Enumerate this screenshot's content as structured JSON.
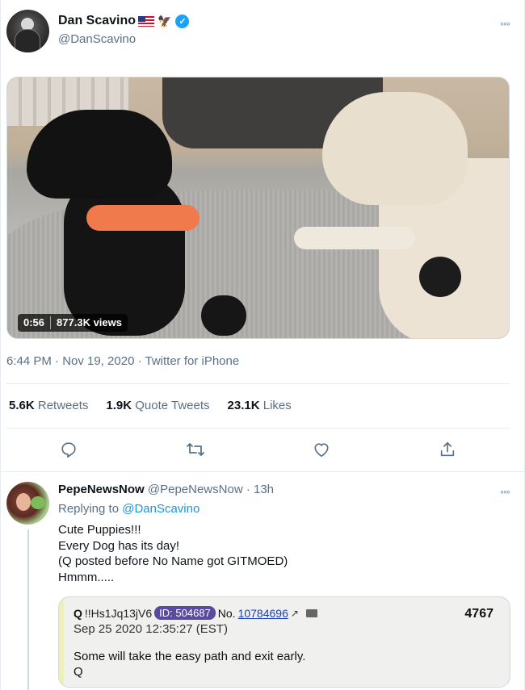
{
  "tweet": {
    "display_name": "Dan Scavino",
    "handle": "@DanScavino",
    "name_emoji_flag": "us-flag-icon",
    "name_emoji_eagle": "🦅",
    "verified": true,
    "video": {
      "duration": "0:56",
      "views": "877.3K views"
    },
    "timestamp": "6:44 PM · Nov 19, 2020 · Twitter for iPhone",
    "stats": {
      "retweets_count": "5.6K",
      "retweets_label": "Retweets",
      "quotes_count": "1.9K",
      "quotes_label": "Quote Tweets",
      "likes_count": "23.1K",
      "likes_label": "Likes"
    },
    "more_glyph": "◦◦◦"
  },
  "reply": {
    "display_name": "PepeNewsNow",
    "meta": "@PepeNewsNow · 13h",
    "replying_prefix": "Replying to ",
    "replying_mention": "@DanScavino",
    "lines": [
      "Cute Puppies!!!",
      "Every Dog has its day!",
      "(Q posted before No Name got GITMOED)",
      "Hmmm....."
    ],
    "more_glyph": "◦◦◦",
    "quoted_post": {
      "name": "Q",
      "tripcode": "!!Hs1Jq13jV6",
      "id_badge": "ID: 504687",
      "no_label": "No.",
      "no_link": "10784696",
      "ext_glyph": "↗",
      "post_number": "4767",
      "date": "Sep 25 2020 12:35:27 (EST)",
      "body_line1": "Some will take the easy path and exit early.",
      "body_line2": "Q"
    }
  },
  "colors": {
    "accent": "#1da1f2",
    "link": "#1b95e0",
    "muted": "#5b7083",
    "id_badge": "#5a4b9e"
  },
  "icons": {
    "reply": "reply-icon",
    "retweet": "retweet-icon",
    "like": "heart-icon",
    "share": "share-icon"
  }
}
